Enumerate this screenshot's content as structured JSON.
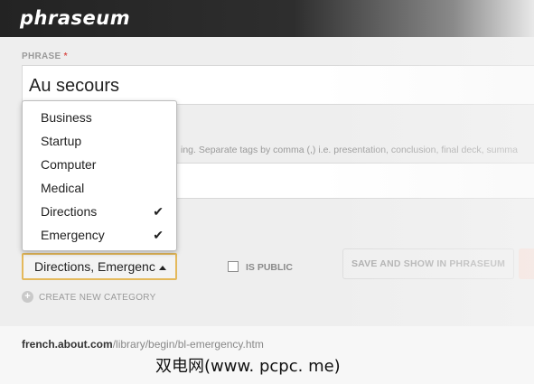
{
  "app": {
    "logo": "phraseum"
  },
  "phrase": {
    "label": "PHRASE",
    "required_mark": "*",
    "value": "Au secours"
  },
  "tags": {
    "hint": "ing. Separate tags by comma (,) i.e. presentation, conclusion, final deck, summa"
  },
  "category": {
    "options": [
      {
        "label": "Business",
        "checked": false
      },
      {
        "label": "Startup",
        "checked": false
      },
      {
        "label": "Computer",
        "checked": false
      },
      {
        "label": "Medical",
        "checked": false
      },
      {
        "label": "Directions",
        "checked": true
      },
      {
        "label": "Emergency",
        "checked": true
      }
    ],
    "check_glyph": "✔",
    "selected_display": "Directions, Emergency",
    "create_label": "CREATE NEW CATEGORY"
  },
  "is_public": {
    "label": "IS PUBLIC",
    "checked": false
  },
  "save_button": {
    "label": "SAVE AND SHOW IN PHRASEUM"
  },
  "source": {
    "domain": "french.about.com",
    "path": "/library/begin/bl-emergency.htm"
  },
  "watermark": "双电网(www. pcpc. me)",
  "colors": {
    "accent_border": "#e4b95b",
    "required": "#d9534f",
    "topbar": "#2a2a2a"
  }
}
